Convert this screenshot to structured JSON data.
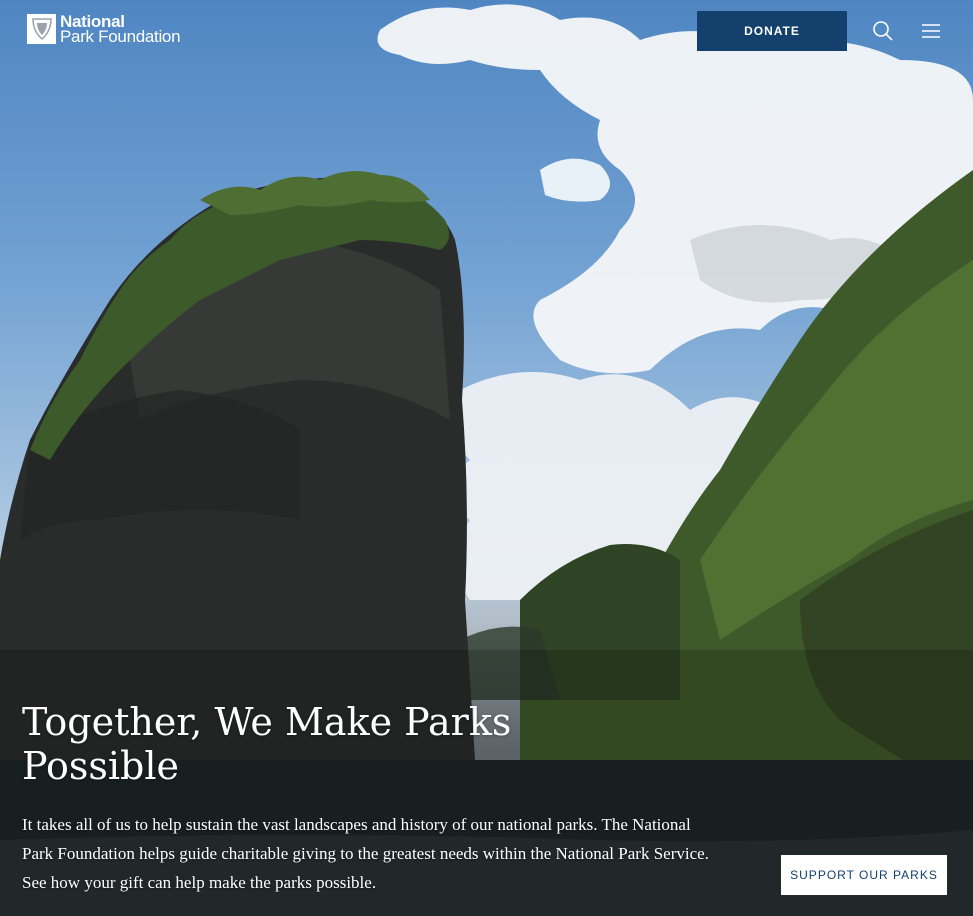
{
  "header": {
    "logo_line1": "National",
    "logo_line2": "Park Foundation",
    "donate_label": "DONATE"
  },
  "hero": {
    "headline": "Together, We Make Parks Possible",
    "body": "It takes all of us to help sustain the vast landscapes and history of our national parks. The National Park Foundation helps guide charitable giving to the greatest needs within the National Park Service. See how your gift can help make the parks possible.",
    "cta_label": "SUPPORT OUR PARKS"
  },
  "colors": {
    "brand_navy": "#14406e",
    "white": "#ffffff"
  },
  "icons": {
    "logo": "arrowhead-icon",
    "search": "search-icon",
    "menu": "hamburger-menu-icon"
  }
}
